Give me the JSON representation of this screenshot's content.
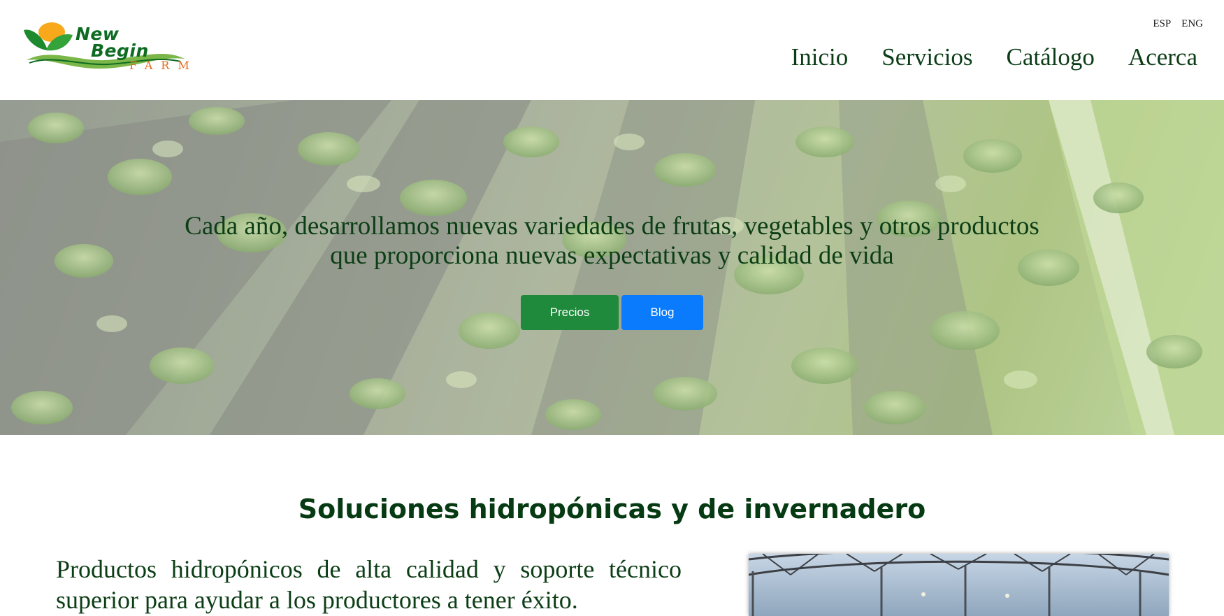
{
  "brand": {
    "line1": "New",
    "line2": "Begin",
    "line3": "FARM"
  },
  "lang": {
    "esp": "ESP",
    "eng": "ENG"
  },
  "nav": {
    "items": [
      {
        "label": "Inicio"
      },
      {
        "label": "Servicios"
      },
      {
        "label": "Catálogo"
      },
      {
        "label": "Acerca"
      }
    ]
  },
  "hero": {
    "line1": "Cada año, desarrollamos nuevas variedades de frutas, vegetables y otros productos",
    "line2": "que proporciona nuevas expectativas y calidad de vida",
    "primary_button": "Precios",
    "secondary_button": "Blog"
  },
  "solutions": {
    "title": "Soluciones hidropónicas y de invernadero",
    "text": "Productos hidropónicos de alta calidad y soporte técnico superior para ayudar a los productores a tener éxito."
  },
  "colors": {
    "brand_green": "#0d6b22",
    "brand_orange": "#e46b1c",
    "nav_text": "#0b3d17",
    "button_green": "#1f8a3b",
    "button_blue": "#0a7bfd"
  },
  "icons": {
    "logo": "leaf-sun-logo-icon"
  }
}
